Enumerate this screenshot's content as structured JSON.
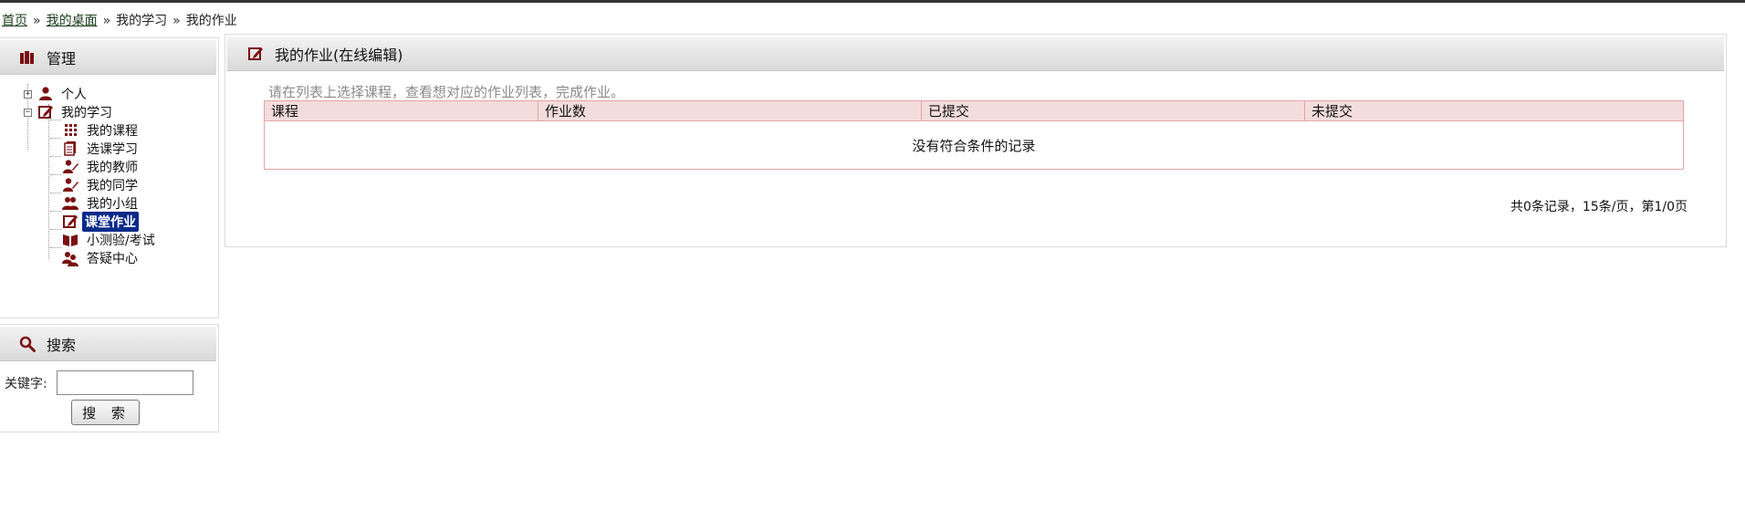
{
  "breadcrumb": {
    "home": "首页",
    "desktop": "我的桌面",
    "study": "我的学习",
    "homework": "我的作业",
    "separator": "»"
  },
  "manage_panel": {
    "title": "管理",
    "tree": {
      "personal": "个人",
      "my_study": "我的学习",
      "children": [
        {
          "label": "我的课程",
          "icon": "grid-icon"
        },
        {
          "label": "选课学习",
          "icon": "books-icon"
        },
        {
          "label": "我的教师",
          "icon": "teacher-icon"
        },
        {
          "label": "我的同学",
          "icon": "classmate-icon"
        },
        {
          "label": "我的小组",
          "icon": "group-icon"
        },
        {
          "label": "课堂作业",
          "icon": "edit-icon",
          "active": true
        },
        {
          "label": "小测验/考试",
          "icon": "book-icon"
        },
        {
          "label": "答疑中心",
          "icon": "qa-users-icon"
        }
      ]
    }
  },
  "search_panel": {
    "title": "搜索",
    "keyword_label": "关键字:",
    "keyword_value": "",
    "button": "搜 索"
  },
  "main_panel": {
    "title": "我的作业(在线编辑)",
    "hint": "请在列表上选择课程，查看想对应的作业列表，完成作业。",
    "table": {
      "columns": [
        "课程",
        "作业数",
        "已提交",
        "未提交"
      ],
      "empty_message": "没有符合条件的记录"
    },
    "pager": "共0条记录，15条/页，第1/0页"
  },
  "colors": {
    "icon": "#7a1010",
    "active_bg": "#0a2a8a",
    "table_border": "#e3a5a5",
    "table_header_bg": "#f3dcdc"
  }
}
